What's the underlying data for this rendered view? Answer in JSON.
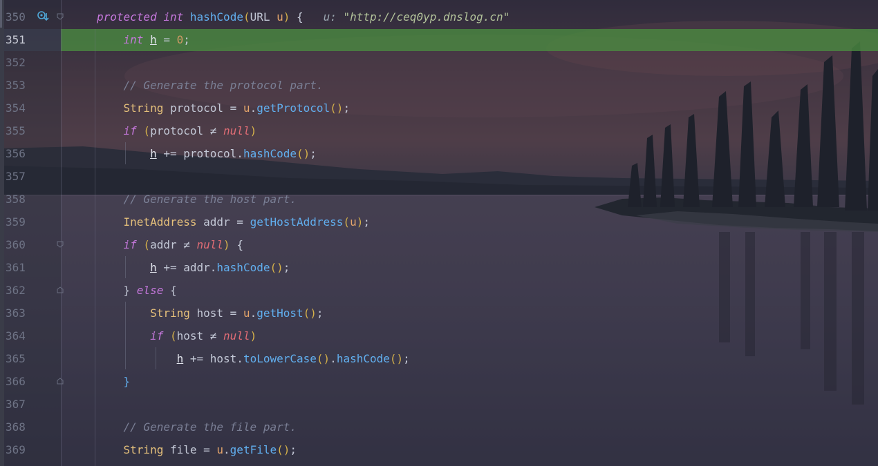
{
  "editor": {
    "current_line": "351",
    "lines": [
      {
        "num": "350",
        "tokens": [
          {
            "t": "protected",
            "c": "kw"
          },
          {
            "t": " ",
            "c": "plain"
          },
          {
            "t": "int",
            "c": "kw"
          },
          {
            "t": " ",
            "c": "plain"
          },
          {
            "t": "hashCode",
            "c": "fn"
          },
          {
            "t": "(",
            "c": "paren"
          },
          {
            "t": "URL",
            "c": "plain"
          },
          {
            "t": " ",
            "c": "plain"
          },
          {
            "t": "u",
            "c": "param"
          },
          {
            "t": ")",
            "c": "paren"
          },
          {
            "t": " {",
            "c": "punc"
          },
          {
            "t": "   u: ",
            "c": "hint"
          },
          {
            "t": "\"http://ceq0yp.dnslog.cn\"",
            "c": "hint-str"
          }
        ]
      },
      {
        "num": "351",
        "tokens": [
          {
            "t": "    ",
            "c": "plain"
          },
          {
            "t": "int",
            "c": "kw"
          },
          {
            "t": " ",
            "c": "plain"
          },
          {
            "t": "h",
            "c": "ulvar"
          },
          {
            "t": " = ",
            "c": "punc"
          },
          {
            "t": "0",
            "c": "num"
          },
          {
            "t": ";",
            "c": "punc"
          }
        ]
      },
      {
        "num": "352",
        "tokens": []
      },
      {
        "num": "353",
        "tokens": [
          {
            "t": "    ",
            "c": "plain"
          },
          {
            "t": "// Generate the protocol part.",
            "c": "cmt"
          }
        ]
      },
      {
        "num": "354",
        "tokens": [
          {
            "t": "    ",
            "c": "plain"
          },
          {
            "t": "String",
            "c": "type"
          },
          {
            "t": " protocol = ",
            "c": "plain"
          },
          {
            "t": "u",
            "c": "param"
          },
          {
            "t": ".",
            "c": "punc"
          },
          {
            "t": "getProtocol",
            "c": "fn"
          },
          {
            "t": "()",
            "c": "paren"
          },
          {
            "t": ";",
            "c": "punc"
          }
        ]
      },
      {
        "num": "355",
        "tokens": [
          {
            "t": "    ",
            "c": "plain"
          },
          {
            "t": "if",
            "c": "kw"
          },
          {
            "t": " (",
            "c": "paren"
          },
          {
            "t": "protocol ",
            "c": "plain"
          },
          {
            "t": "≠",
            "c": "punc"
          },
          {
            "t": " ",
            "c": "plain"
          },
          {
            "t": "null",
            "c": "null"
          },
          {
            "t": ")",
            "c": "paren"
          }
        ]
      },
      {
        "num": "356",
        "tokens": [
          {
            "t": "        ",
            "c": "plain"
          },
          {
            "t": "h",
            "c": "ulvar"
          },
          {
            "t": " += protocol.",
            "c": "plain"
          },
          {
            "t": "hashCode",
            "c": "fn"
          },
          {
            "t": "()",
            "c": "paren"
          },
          {
            "t": ";",
            "c": "punc"
          }
        ]
      },
      {
        "num": "357",
        "tokens": []
      },
      {
        "num": "358",
        "tokens": [
          {
            "t": "    ",
            "c": "plain"
          },
          {
            "t": "// Generate the host part.",
            "c": "cmt"
          }
        ]
      },
      {
        "num": "359",
        "tokens": [
          {
            "t": "    ",
            "c": "plain"
          },
          {
            "t": "InetAddress",
            "c": "type"
          },
          {
            "t": " addr = ",
            "c": "plain"
          },
          {
            "t": "getHostAddress",
            "c": "fn"
          },
          {
            "t": "(",
            "c": "paren"
          },
          {
            "t": "u",
            "c": "param"
          },
          {
            "t": ")",
            "c": "paren"
          },
          {
            "t": ";",
            "c": "punc"
          }
        ]
      },
      {
        "num": "360",
        "tokens": [
          {
            "t": "    ",
            "c": "plain"
          },
          {
            "t": "if",
            "c": "kw"
          },
          {
            "t": " (",
            "c": "paren"
          },
          {
            "t": "addr ",
            "c": "plain"
          },
          {
            "t": "≠",
            "c": "punc"
          },
          {
            "t": " ",
            "c": "plain"
          },
          {
            "t": "null",
            "c": "null"
          },
          {
            "t": ")",
            "c": "paren"
          },
          {
            "t": " {",
            "c": "punc"
          }
        ]
      },
      {
        "num": "361",
        "tokens": [
          {
            "t": "        ",
            "c": "plain"
          },
          {
            "t": "h",
            "c": "ulvar"
          },
          {
            "t": " += addr.",
            "c": "plain"
          },
          {
            "t": "hashCode",
            "c": "fn"
          },
          {
            "t": "()",
            "c": "paren"
          },
          {
            "t": ";",
            "c": "punc"
          }
        ]
      },
      {
        "num": "362",
        "tokens": [
          {
            "t": "    ",
            "c": "plain"
          },
          {
            "t": "} ",
            "c": "punc"
          },
          {
            "t": "else",
            "c": "kw"
          },
          {
            "t": " {",
            "c": "punc"
          }
        ]
      },
      {
        "num": "363",
        "tokens": [
          {
            "t": "        ",
            "c": "plain"
          },
          {
            "t": "String",
            "c": "type"
          },
          {
            "t": " host = ",
            "c": "plain"
          },
          {
            "t": "u",
            "c": "param"
          },
          {
            "t": ".",
            "c": "punc"
          },
          {
            "t": "getHost",
            "c": "fn"
          },
          {
            "t": "()",
            "c": "paren"
          },
          {
            "t": ";",
            "c": "punc"
          }
        ]
      },
      {
        "num": "364",
        "tokens": [
          {
            "t": "        ",
            "c": "plain"
          },
          {
            "t": "if",
            "c": "kw"
          },
          {
            "t": " (",
            "c": "paren"
          },
          {
            "t": "host ",
            "c": "plain"
          },
          {
            "t": "≠",
            "c": "punc"
          },
          {
            "t": " ",
            "c": "plain"
          },
          {
            "t": "null",
            "c": "null"
          },
          {
            "t": ")",
            "c": "paren"
          }
        ]
      },
      {
        "num": "365",
        "tokens": [
          {
            "t": "            ",
            "c": "plain"
          },
          {
            "t": "h",
            "c": "ulvar"
          },
          {
            "t": " += host.",
            "c": "plain"
          },
          {
            "t": "toLowerCase",
            "c": "fn"
          },
          {
            "t": "()",
            "c": "paren"
          },
          {
            "t": ".",
            "c": "punc"
          },
          {
            "t": "hashCode",
            "c": "fn"
          },
          {
            "t": "()",
            "c": "paren"
          },
          {
            "t": ";",
            "c": "punc"
          }
        ]
      },
      {
        "num": "366",
        "tokens": [
          {
            "t": "    ",
            "c": "plain"
          },
          {
            "t": "}",
            "c": "fn"
          }
        ]
      },
      {
        "num": "367",
        "tokens": []
      },
      {
        "num": "368",
        "tokens": [
          {
            "t": "    ",
            "c": "plain"
          },
          {
            "t": "// Generate the file part.",
            "c": "cmt"
          }
        ]
      },
      {
        "num": "369",
        "tokens": [
          {
            "t": "    ",
            "c": "plain"
          },
          {
            "t": "String",
            "c": "type"
          },
          {
            "t": " file = ",
            "c": "plain"
          },
          {
            "t": "u",
            "c": "param"
          },
          {
            "t": ".",
            "c": "punc"
          },
          {
            "t": "getFile",
            "c": "fn"
          },
          {
            "t": "()",
            "c": "paren"
          },
          {
            "t": ";",
            "c": "punc"
          }
        ]
      }
    ]
  },
  "icons": {
    "breakpoint_icon": "override-method-icon",
    "fold_icon": "fold-marker-icon"
  },
  "colors": {
    "current_line_highlight": "#4a8c40",
    "keyword": "#c678dd",
    "type": "#e5c07b",
    "function": "#61afef",
    "comment": "#7a7f95"
  }
}
